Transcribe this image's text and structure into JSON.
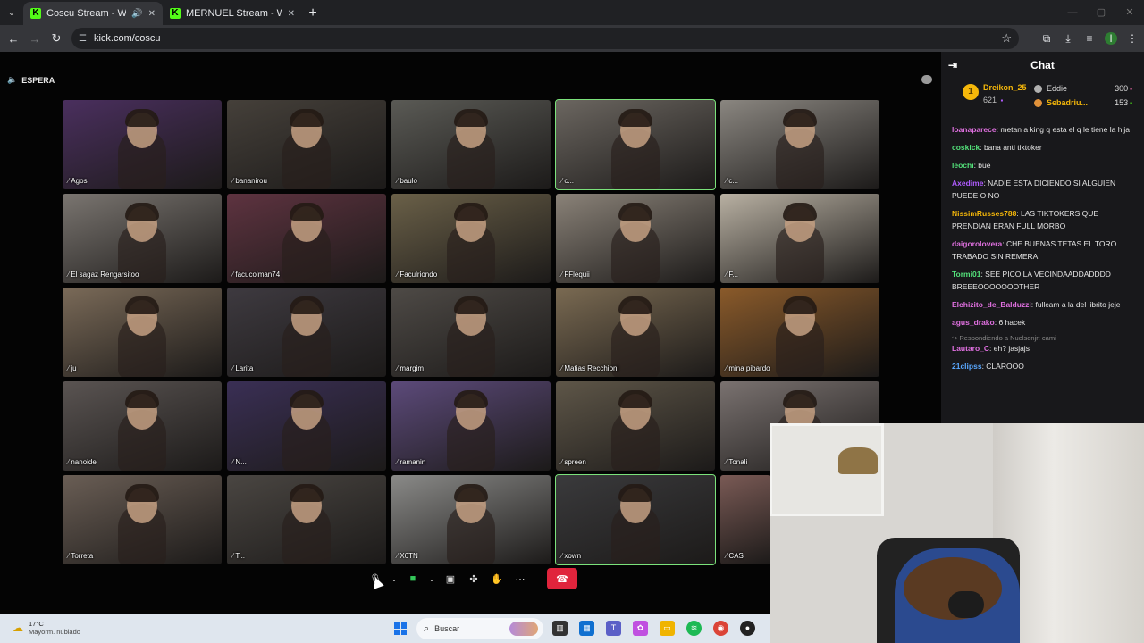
{
  "browser": {
    "tabs": [
      {
        "title": "Coscu Stream - Watch Live",
        "active": true
      },
      {
        "title": "MERNUEL Stream - Watch Live",
        "active": false
      }
    ],
    "url": "kick.com/coscu"
  },
  "stream": {
    "status_label": "ESPERA",
    "participants": [
      {
        "name": "Agos",
        "bg": "#4a2f5e"
      },
      {
        "name": "bananirou",
        "bg": "#45403a"
      },
      {
        "name": "baulo",
        "bg": "#5a5a55"
      },
      {
        "name": "c...",
        "bg": "#6b6660",
        "speaking": true
      },
      {
        "name": "c...",
        "bg": "#8a8680"
      },
      {
        "name": "El sagaz Rengarsitoo",
        "bg": "#7a7570"
      },
      {
        "name": "facucolman74",
        "bg": "#5e3340"
      },
      {
        "name": "Faculriondo",
        "bg": "#6a6048"
      },
      {
        "name": "FFlequii",
        "bg": "#8a8278"
      },
      {
        "name": "F...",
        "bg": "#b8b0a2"
      },
      {
        "name": "ju",
        "bg": "#7a6a58"
      },
      {
        "name": "Larita",
        "bg": "#3e3a40"
      },
      {
        "name": "margim",
        "bg": "#4e4a46"
      },
      {
        "name": "Matias Recchioni",
        "bg": "#7a6a52"
      },
      {
        "name": "mina pibardo",
        "bg": "#8a5a2a"
      },
      {
        "name": "nanoide",
        "bg": "#5a5452"
      },
      {
        "name": "N...",
        "bg": "#3a2f55"
      },
      {
        "name": "ramanin",
        "bg": "#5c4a7a"
      },
      {
        "name": "spreen",
        "bg": "#5e5648"
      },
      {
        "name": "Tonali",
        "bg": "#7a7270"
      },
      {
        "name": "Torreta",
        "bg": "#6a5e55"
      },
      {
        "name": "T...",
        "bg": "#4a4642"
      },
      {
        "name": "X6TN",
        "bg": "#8a8a88"
      },
      {
        "name": "xown",
        "bg": "#3a3a3c",
        "speaking": true
      },
      {
        "name": "CAS",
        "bg": "#7a5a55"
      }
    ]
  },
  "chat": {
    "title": "Chat",
    "leaderboard": {
      "top": {
        "rank": "1",
        "name": "Dreikon_25",
        "count": "621"
      },
      "others": [
        {
          "name": "Eddie",
          "amount": "300",
          "badge_color": "#b0b0b0",
          "name_color": "#dddddd"
        },
        {
          "name": "Sebadriu...",
          "amount": "153",
          "badge_color": "#e0913a",
          "name_color": "#f5b70a"
        }
      ]
    },
    "messages": [
      {
        "user": "loanaparece",
        "text": "metan a king q esta el q le tiene la hija",
        "color": "#e070e0"
      },
      {
        "user": "coskick",
        "text": "bana anti tiktoker",
        "color": "#53e07a"
      },
      {
        "user": "leochi",
        "text": "bue",
        "color": "#53e07a"
      },
      {
        "user": "Axedime",
        "text": "NADIE ESTA DICIENDO SI ALGUIEN PUEDE O NO",
        "color": "#b05cff"
      },
      {
        "user": "NissimRusses788",
        "text": "LAS TIKTOKERS QUE PRENDIAN ERAN FULL MORBO",
        "color": "#f5b70a"
      },
      {
        "user": "daigorolovera",
        "text": "CHE BUENAS TETAS EL TORO TRABADO SIN REMERA",
        "color": "#e070e0"
      },
      {
        "user": "Tormi01",
        "text": "SEE PICO LA VECINDAADDADDDD BREEEOOOOOOOTHER",
        "color": "#53e07a"
      },
      {
        "user": "Elchizito_de_Balduzzi",
        "text": "fullcam a la del librito jeje",
        "color": "#e070e0"
      },
      {
        "user": "agus_drako",
        "text": "6 hacek",
        "color": "#e070e0"
      },
      {
        "reply_note": "Respondiendo a Nuelsonjr: cami",
        "user": "Lautaro_C",
        "text": "eh? jasjajs",
        "color": "#e070e0"
      },
      {
        "user": "21clipss",
        "text": "CLAROOO",
        "color": "#5aa8ff"
      }
    ]
  },
  "taskbar": {
    "weather_temp": "17°C",
    "weather_desc": "Mayorm. nublado",
    "search_placeholder": "Buscar"
  }
}
